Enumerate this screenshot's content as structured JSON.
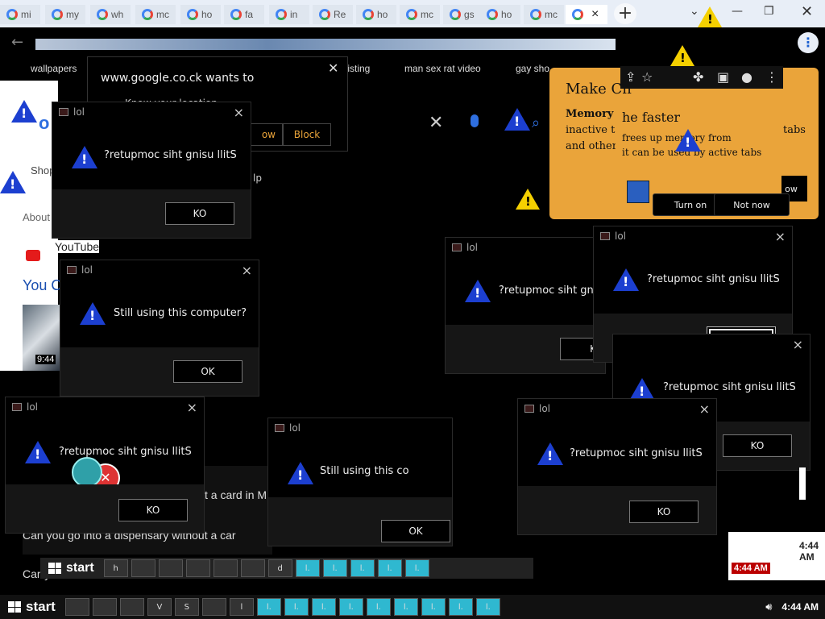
{
  "browser": {
    "tabs": [
      "mi",
      "my",
      "wh",
      "mc",
      "ho",
      "fa",
      "in",
      "Re",
      "ho",
      "mc",
      "gs",
      "ho",
      "mc"
    ],
    "active_tab_close": "×",
    "new_tab": "+",
    "bookmarks": [
      "wallpapers",
      "fisting",
      "man sex rat video",
      "gay sho"
    ]
  },
  "permission": {
    "title": "www.google.co.ck wants to",
    "item": "Know your location",
    "allow": "ow",
    "block": "Block"
  },
  "promo": {
    "title": "Make Ch",
    "title2": "he faster",
    "line1": "Memory S",
    "line1b": "frees up memory from",
    "line2": "inactive ta",
    "line2b": "it can be used by active tabs",
    "line3": "and other",
    "suffix_tabs": "tabs",
    "suffix_now": "ow",
    "turn_on": "Turn on",
    "not_now": "Not now"
  },
  "page": {
    "shop": "Shop",
    "about": "About",
    "youtube": "YouTube",
    "you": "You C",
    "duration": "9:44",
    "question1": "t a card in M",
    "question2": "Can you go into a dispensary without a car",
    "carry": "Carry",
    "help": "lp"
  },
  "dialogs": {
    "title": "lol",
    "msg_reversed": "?retupmoc siht gnisu llitS",
    "msg_reversed_cut": "?retupmoc siht gnisu",
    "msg_still": "Still using this computer?",
    "msg_still_cut": "Still using this co",
    "ok_reversed": "KO",
    "ok": "OK",
    "k_cut": "K",
    "close": "×"
  },
  "taskbar_inner": {
    "start": "start",
    "items": [
      "h",
      "",
      "",
      "",
      "",
      "",
      "d",
      "l.",
      "l.",
      "l.",
      "l.",
      "l."
    ],
    "time": "4:44 AM"
  },
  "taskbar_main": {
    "start": "start",
    "items": [
      "",
      "",
      "",
      "V",
      "S",
      "",
      "l",
      "l.",
      "l.",
      "l.",
      "l.",
      "l.",
      "l.",
      "l.",
      "l.",
      "l."
    ],
    "time": "4:44 AM"
  },
  "time_right": "4:44 AM"
}
